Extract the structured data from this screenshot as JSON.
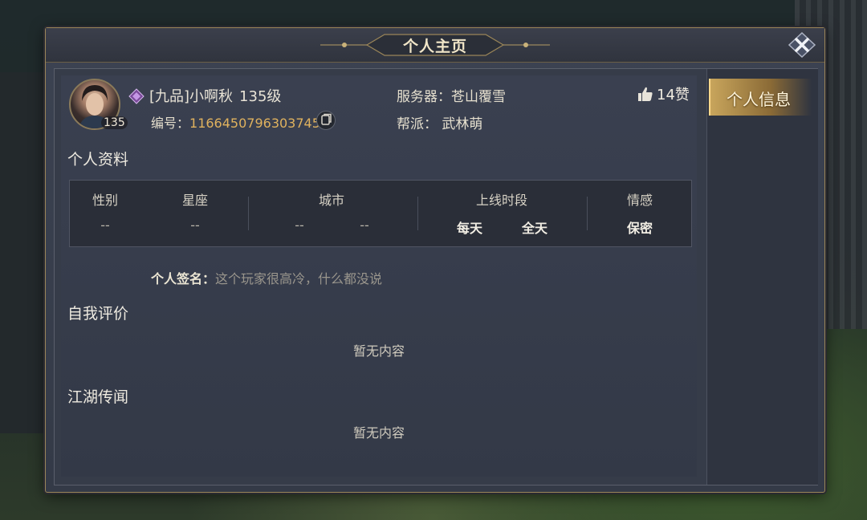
{
  "window": {
    "title": "个人主页"
  },
  "header": {
    "avatar_level": "135",
    "rank_name": "[九品]小啊秋",
    "level_text": "135级",
    "id_label": "编号：",
    "id_value": "1166450796303745",
    "server_label": "服务器：",
    "server_value": "苍山覆雪",
    "guild_label": "帮派：",
    "guild_value": "武林萌",
    "likes": "14赞"
  },
  "side_tabs": [
    {
      "label": "个人信息",
      "selected": true
    }
  ],
  "profile": {
    "title": "个人资料",
    "columns": [
      {
        "label": "性别",
        "values": [
          "--"
        ]
      },
      {
        "label": "星座",
        "values": [
          "--"
        ]
      },
      {
        "label": "城市",
        "values": [
          "--",
          "--"
        ]
      },
      {
        "label": "上线时段",
        "values": [
          "每天",
          "全天"
        ]
      },
      {
        "label": "情感",
        "values": [
          "保密"
        ]
      }
    ],
    "signature_label": "个人签名：",
    "signature_value": "这个玩家很高冷，什么都没说"
  },
  "self_eval": {
    "title": "自我评价",
    "empty_text": "暂无内容"
  },
  "rumors": {
    "title": "江湖传闻",
    "empty_text": "暂无内容"
  },
  "colors": {
    "accent_gold": "#e0b25e",
    "panel": "#363c49",
    "tab_gold": "#c8a55c"
  },
  "icons": [
    "close-icon",
    "rank-diamond-icon",
    "copy-icon",
    "thumbs-up-icon"
  ]
}
